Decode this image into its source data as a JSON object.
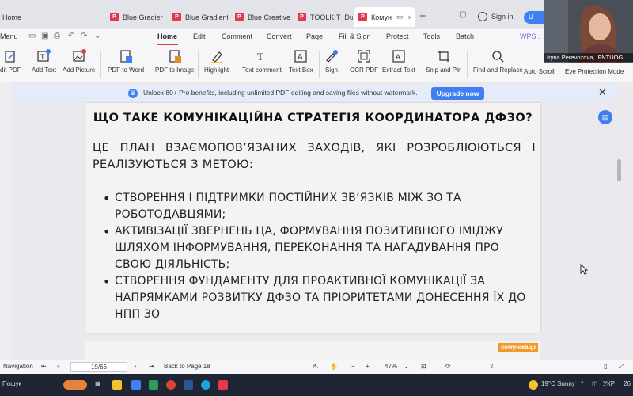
{
  "tabs": {
    "home": "Home",
    "items": [
      {
        "label": "Blue Gradier",
        "active": false
      },
      {
        "label": "Blue Gradient I",
        "active": false
      },
      {
        "label": "Blue Creative I",
        "active": false
      },
      {
        "label": "TOOLKIT_Duall",
        "active": false
      },
      {
        "label": "Комун",
        "active": true
      }
    ],
    "signin": "Sign in",
    "upgrade": "U"
  },
  "menu": {
    "left": "Menu",
    "items": [
      "Home",
      "Edit",
      "Comment",
      "Convert",
      "Page",
      "Fill & Sign",
      "Protect",
      "Tools",
      "Batch"
    ],
    "active": "Home",
    "wps": "WPS ."
  },
  "toolbar": {
    "items": [
      {
        "label": "dit PDF",
        "icon": "edit-pdf-icon"
      },
      {
        "label": "Add Text",
        "icon": "add-text-icon"
      },
      {
        "label": "Add Picture",
        "icon": "add-picture-icon"
      },
      {
        "label": "PDF to Word",
        "icon": "pdf-to-word-icon"
      },
      {
        "label": "PDF to Image",
        "icon": "pdf-to-image-icon"
      },
      {
        "label": "Highlight",
        "icon": "highlight-icon"
      },
      {
        "label": "Text comment",
        "icon": "text-comment-icon"
      },
      {
        "label": "Text Box",
        "icon": "text-box-icon"
      },
      {
        "label": "Sign",
        "icon": "sign-icon"
      },
      {
        "label": "OCR PDF",
        "icon": "ocr-icon"
      },
      {
        "label": "Extract Text",
        "icon": "extract-text-icon"
      },
      {
        "label": "Snip and Pin",
        "icon": "snip-icon"
      },
      {
        "label": "Find and Replace",
        "icon": "search-icon"
      }
    ],
    "right": [
      "Auto Scroll",
      "Eye Protection Mode"
    ]
  },
  "promo": {
    "text": "Unlock 80+ Pro benefits, including unlimited PDF editing and saving files without watermark.",
    "button": "Upgrade now"
  },
  "document": {
    "title": "ЩО ТАКЕ КОМУНІКАЦІЙНА СТРАТЕГІЯ КООРДИНАТОРА ДФЗО?",
    "intro": "ЦЕ ПЛАН ВЗАЄМОПОВ’ЯЗАНИХ ЗАХОДІВ, ЯКІ РОЗРОБЛЮЮТЬСЯ І РЕАЛІЗУЮТЬСЯ З МЕТОЮ:",
    "bullets": [
      "СТВОРЕННЯ І ПІДТРИМКИ ПОСТІЙНИХ ЗВ’ЯЗКІВ МІЖ ЗО ТА РОБОТОДАВЦЯМИ;",
      "АКТИВІЗАЦІЇ ЗВЕРНЕНЬ ЦА, ФОРМУВАННЯ ПОЗИТИВНОГО ІМІДЖУ ШЛЯХОМ ІНФОРМУВАННЯ, ПЕРЕКОНАННЯ ТА НАГАДУВАННЯ ПРО СВОЮ ДІЯЛЬНІСТЬ;",
      "СТВОРЕННЯ ФУНДАМЕНТУ ДЛЯ ПРОАКТИВНОЇ КОМУНІКАЦІЇ ЗА НАПРЯМКАМИ РОЗВИТКУ ДФЗО ТА ПРІОРИТЕТАМИ ДОНЕСЕННЯ ЇХ ДО НПП ЗО"
    ],
    "next_page_badge": "комунікації"
  },
  "status": {
    "navigation": "Navigation",
    "page": "19/66",
    "back": "Back to Page 18",
    "zoom": "47%"
  },
  "taskbar": {
    "search": "Пошук",
    "weather": "19°C Sunny",
    "lang": "УКР",
    "time": "26"
  },
  "webcam": {
    "caption": "Iryna Perevozova, IFNTUOG"
  }
}
